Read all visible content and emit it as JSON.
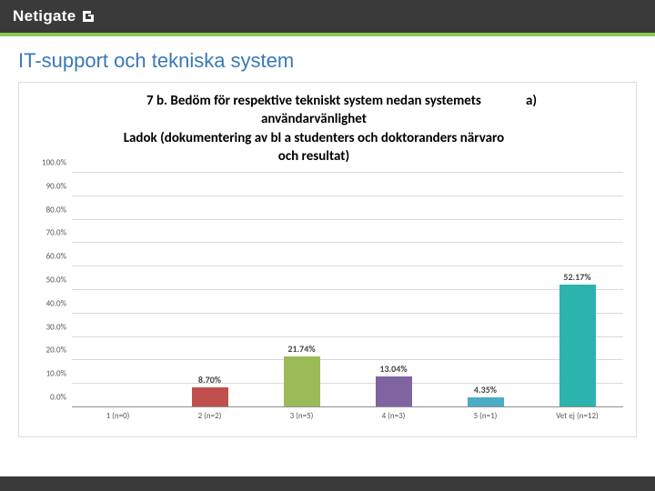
{
  "brand": {
    "name": "Netigate"
  },
  "page": {
    "title": "IT-support och tekniska system",
    "chart_title": "7 b. Bedöm för respektive tekniskt system nedan systemets användarvänlighet\nLadok (dokumentering av bl a studenters och doktoranders närvaro och resultat)",
    "chart_title_side": "a)"
  },
  "chart_data": {
    "type": "bar",
    "title": "7 b. Bedöm för respektive tekniskt system nedan systemets användarvänlighet – Ladok (dokumentering av bl a studenters och doktoranders närvaro och resultat)  a)",
    "xlabel": "",
    "ylabel": "",
    "ylim": [
      0,
      100
    ],
    "yticks": [
      "0.0%",
      "10.0%",
      "20.0%",
      "30.0%",
      "40.0%",
      "50.0%",
      "60.0%",
      "70.0%",
      "80.0%",
      "90.0%",
      "100.0%"
    ],
    "categories": [
      "1 (n=0)",
      "2 (n=2)",
      "3 (n=5)",
      "4 (n=3)",
      "5 (n=1)",
      "Vet ej (n=12)"
    ],
    "values": [
      0,
      8.7,
      21.74,
      13.04,
      4.35,
      52.17
    ],
    "value_labels": [
      "",
      "8.70%",
      "21.74%",
      "13.04%",
      "4.35%",
      "52.17%"
    ],
    "colors": [
      "#4f81bd",
      "#c0504d",
      "#9bbb59",
      "#8064a2",
      "#4bacc6",
      "#2cb3ad"
    ]
  }
}
